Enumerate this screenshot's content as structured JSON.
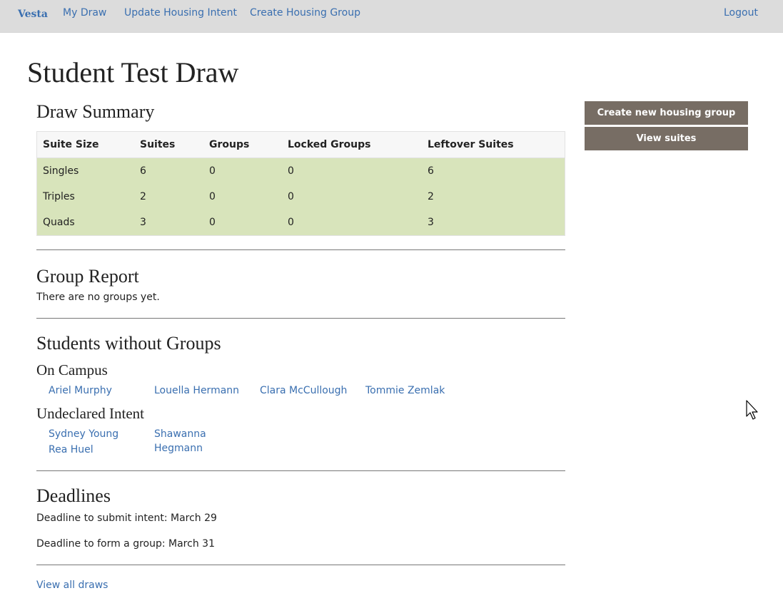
{
  "navbar": {
    "brand": "Vesta",
    "links": [
      "My Draw",
      "Update Housing Intent",
      "Create Housing Group"
    ],
    "logout": "Logout"
  },
  "page_title": "Student Test Draw",
  "draw_summary": {
    "heading": "Draw Summary",
    "columns": [
      "Suite Size",
      "Suites",
      "Groups",
      "Locked Groups",
      "Leftover Suites"
    ],
    "rows": [
      [
        "Singles",
        "6",
        "0",
        "0",
        "6"
      ],
      [
        "Triples",
        "2",
        "0",
        "0",
        "2"
      ],
      [
        "Quads",
        "3",
        "0",
        "0",
        "3"
      ]
    ],
    "row_color": "#d8e4bb"
  },
  "group_report": {
    "heading": "Group Report",
    "text": "There are no groups yet."
  },
  "students_without_groups": {
    "heading": "Students without Groups",
    "on_campus": {
      "heading": "On Campus",
      "students": [
        "Ariel Murphy",
        "Louella Hermann",
        "Clara McCullough",
        "Tommie Zemlak"
      ]
    },
    "undeclared": {
      "heading": "Undeclared Intent",
      "students": [
        "Sydney Young",
        "Shawanna Hegmann",
        "Rea Huel"
      ]
    }
  },
  "deadlines": {
    "heading": "Deadlines",
    "items": [
      "Deadline to submit intent: March 29",
      "Deadline to form a group: March 31"
    ]
  },
  "view_all_draws": "View all draws",
  "sidebar": {
    "create_button": "Create new housing group",
    "view_button": "View suites",
    "button_color": "#776d64"
  },
  "icons": {
    "cursor": "mouse-pointer-icon"
  }
}
